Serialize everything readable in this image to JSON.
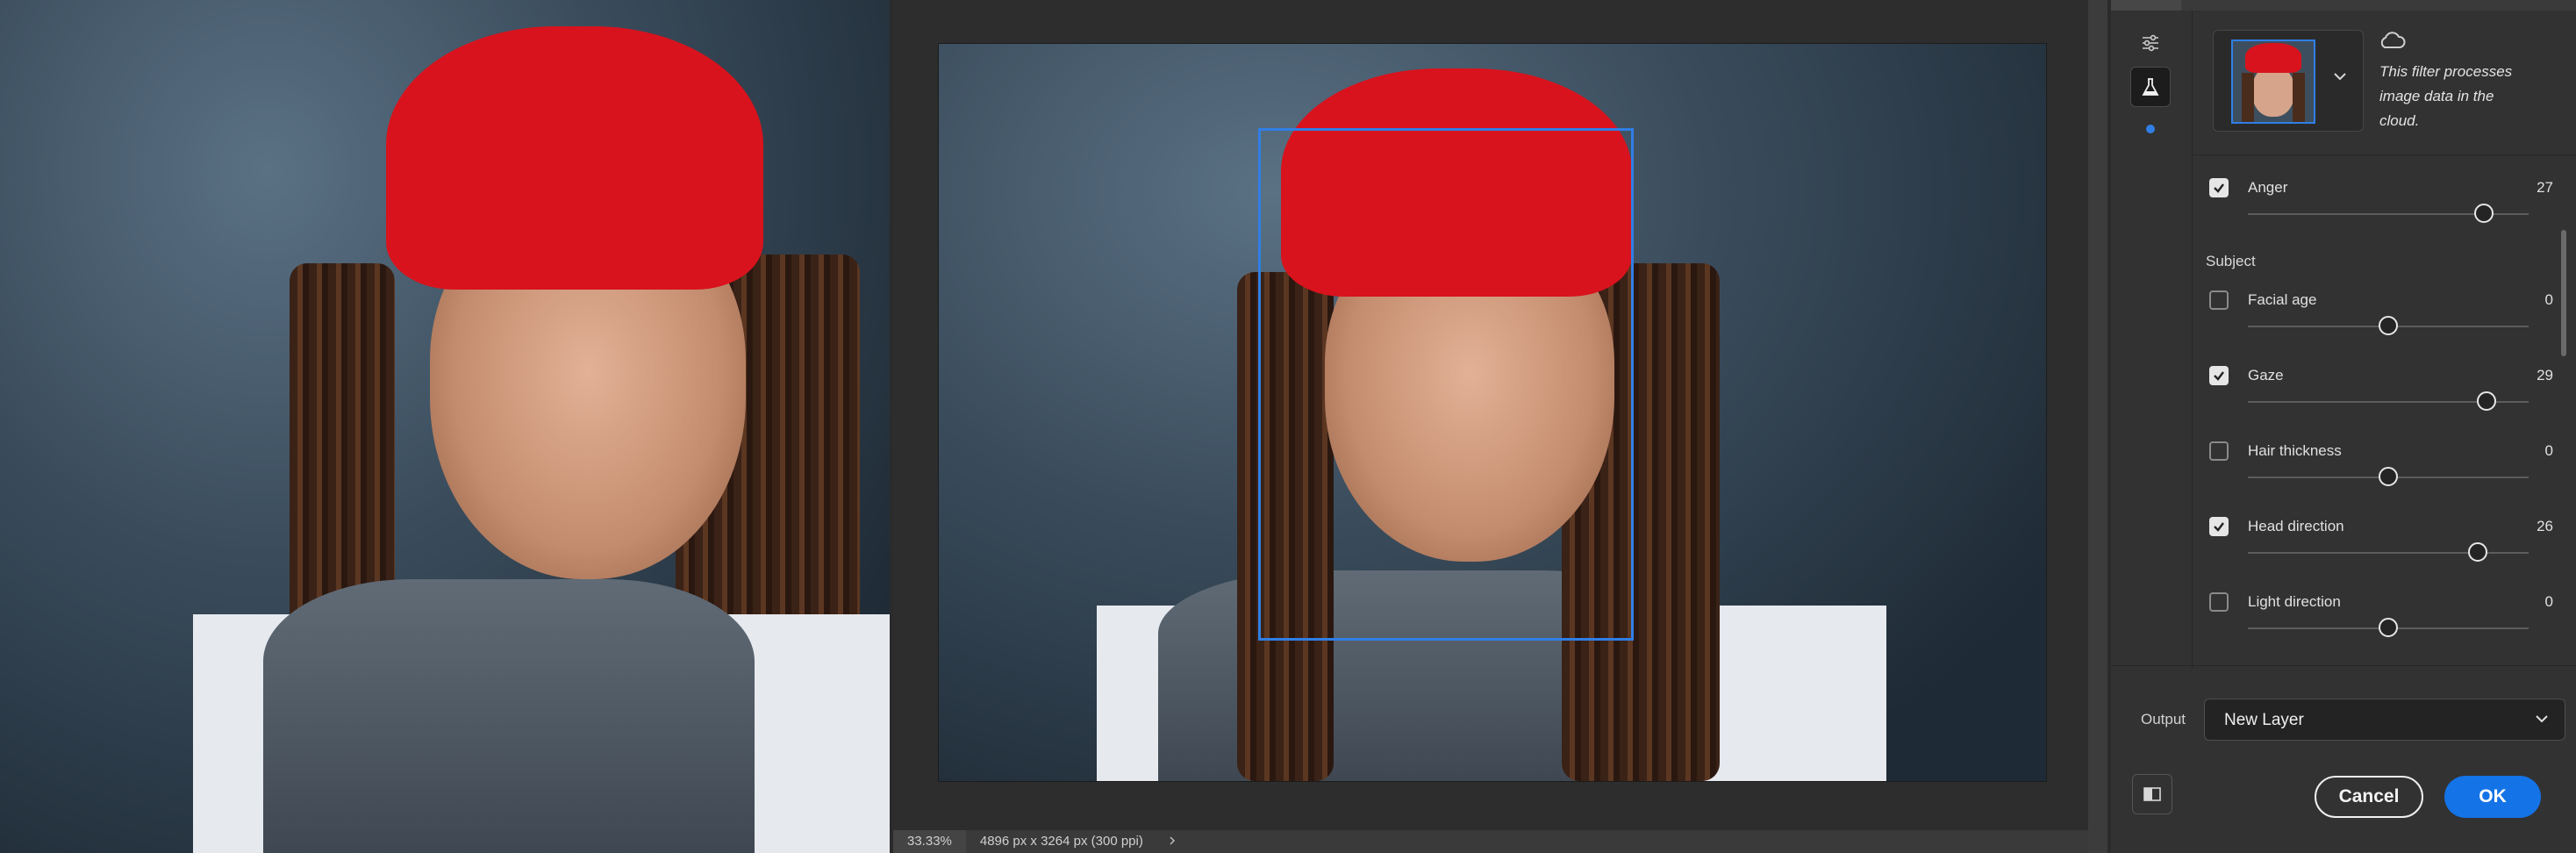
{
  "filter_info": {
    "cloud_note": "This filter processes image data in the cloud."
  },
  "parameters": {
    "anger": {
      "label": "Anger",
      "value": "27",
      "checked": true,
      "slider_fraction": 0.84
    },
    "section_subject": "Subject",
    "facial_age": {
      "label": "Facial age",
      "value": "0",
      "checked": false,
      "slider_fraction": 0.5
    },
    "gaze": {
      "label": "Gaze",
      "value": "29",
      "checked": true,
      "slider_fraction": 0.85
    },
    "hair_thickness": {
      "label": "Hair thickness",
      "value": "0",
      "checked": false,
      "slider_fraction": 0.5
    },
    "head_direction": {
      "label": "Head direction",
      "value": "26",
      "checked": true,
      "slider_fraction": 0.82
    },
    "light_direction": {
      "label": "Light direction",
      "value": "0",
      "checked": false,
      "slider_fraction": 0.5
    }
  },
  "output": {
    "label": "Output",
    "selected": "New Layer"
  },
  "buttons": {
    "cancel": "Cancel",
    "ok": "OK"
  },
  "status_bar": {
    "zoom": "33.33%",
    "dimensions": "4896 px x 3264 px (300 ppi)"
  },
  "icons": {
    "rail": [
      "sliders-icon",
      "flask-icon"
    ],
    "cloud": "cloud-icon",
    "compare": "compare-icon",
    "dropdown": "chevron-down-icon"
  },
  "colors": {
    "accent_blue": "#1473e6",
    "face_box": "#2f7fe6",
    "bandana_red": "#d8131d"
  }
}
